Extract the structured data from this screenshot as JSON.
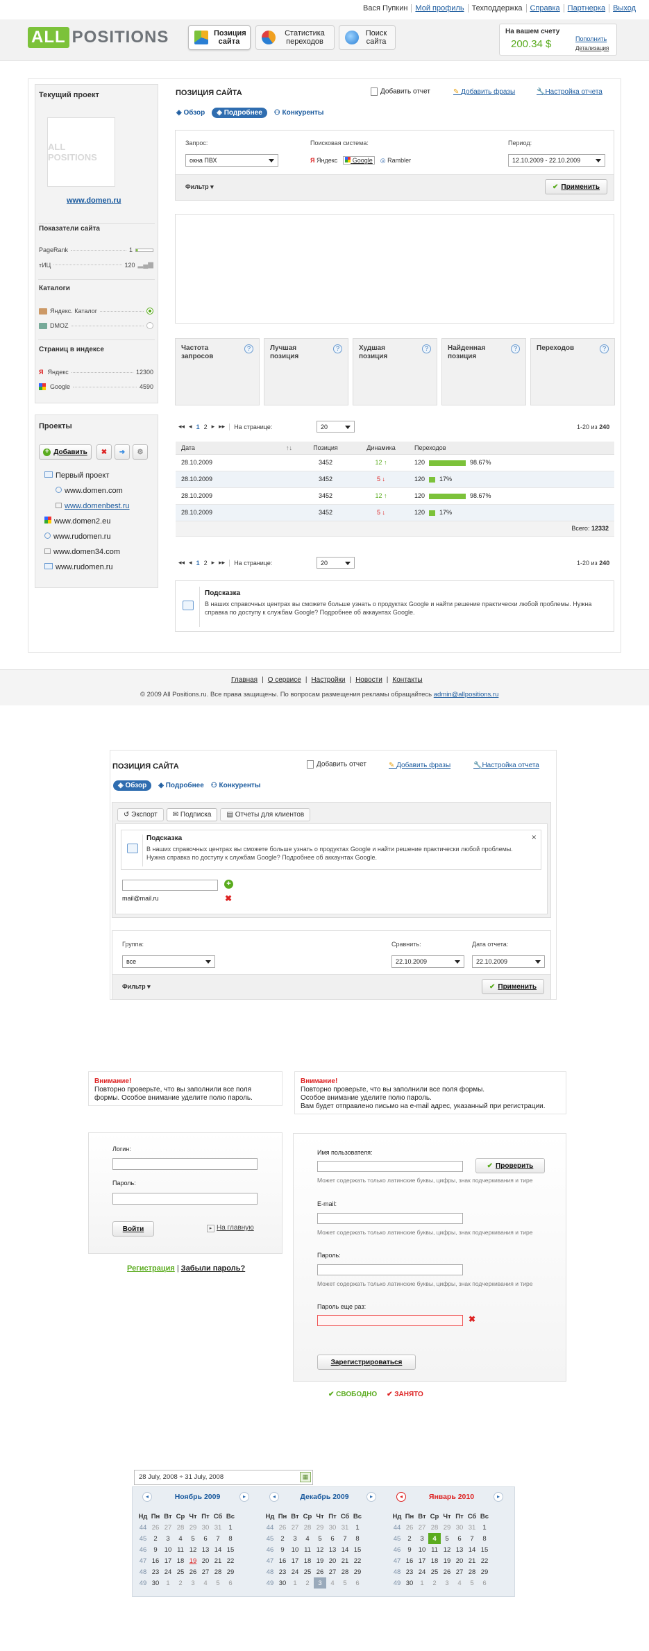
{
  "topnav": [
    "Вася Пупкин",
    "Мой профиль",
    "Техподдержка",
    "Справка",
    "Партнерка",
    "Выход"
  ],
  "logo": {
    "all": "ALL",
    "positions": "POSITIONS"
  },
  "mainnav": [
    {
      "label": "Позиция сайта",
      "color": "#2a7fd4"
    },
    {
      "label": "Статистика переходов",
      "color": "#f0a020"
    },
    {
      "label": "Поиск сайта",
      "color": "#3b8de0"
    }
  ],
  "account": {
    "title": "На вашем счету",
    "amount": "200.34 $",
    "topup": "Пополнить",
    "details": "Детализация"
  },
  "sidebar": {
    "current_project": "Текущий проект",
    "domain": "www.domen.ru",
    "indicators_title": "Показатели сайта",
    "pagerank_label": "PageRank",
    "pagerank_value": "1",
    "tic_label": "тИЦ",
    "tic_value": "120",
    "catalogs_title": "Каталоги",
    "catalog1": "Яндекс. Каталог",
    "catalog2": "DMOZ",
    "index_title": "Страниц в индексе",
    "index1_label": "Яндекс",
    "index1_value": "12300",
    "index2_label": "Google",
    "index2_value": "4590",
    "projects_title": "Проекты",
    "add_label": "Добавить",
    "tree": [
      "Первый проект",
      "www.domen.com",
      "www.domenbest.ru",
      "www.domen2.eu",
      "www.rudomen.ru",
      "www.domen34.com",
      "www.rudomen.ru"
    ]
  },
  "main": {
    "title": "ПОЗИЦИЯ САЙТА",
    "add_report": "Добавить отчет",
    "add_phrases": "Добавить фразы",
    "report_settings": "Настройка отчета",
    "tabs": [
      "Обзор",
      "Подробнее",
      "Конкуренты"
    ],
    "query_label": "Запрос:",
    "query_value": "окна ПВХ",
    "engine_label": "Поисковая система:",
    "engines": [
      "Яндекс",
      "Google",
      "Rambler"
    ],
    "period_label": "Период:",
    "period_value": "12.10.2009 - 22.10.2009",
    "filter": "Фильтр",
    "apply": "Применить",
    "metrics": [
      "Частота запросов",
      "Лучшая позиция",
      "Худшая позиция",
      "Найденная позиция",
      "Переходов"
    ],
    "pager": {
      "pages": [
        "1",
        "2"
      ],
      "per_page_label": "На странице:",
      "per_page": "20",
      "range": "1-20 из",
      "total": "240"
    },
    "table_headers": [
      "Дата",
      "Позиция",
      "Динамика",
      "Переходов"
    ],
    "rows": [
      {
        "date": "28.10.2009",
        "pos": "3452",
        "dyn": "12",
        "dir": "up",
        "clicks": "120",
        "pct": "98.67%",
        "fill": 0.9867
      },
      {
        "date": "28.10.2009",
        "pos": "3452",
        "dyn": "5",
        "dir": "down",
        "clicks": "120",
        "pct": "17%",
        "fill": 0.17
      },
      {
        "date": "28.10.2009",
        "pos": "3452",
        "dyn": "12",
        "dir": "up",
        "clicks": "120",
        "pct": "98.67%",
        "fill": 0.9867
      },
      {
        "date": "28.10.2009",
        "pos": "3452",
        "dyn": "5",
        "dir": "down",
        "clicks": "120",
        "pct": "17%",
        "fill": 0.17
      }
    ],
    "total_label": "Всего:",
    "total_value": "12332",
    "hint_title": "Подсказка",
    "hint_text": "В наших справочных центрах вы сможете больше узнать о продуктах Google и найти решение практически любой проблемы. Нужна справка по доступу к службам Google? Подробнее об аккаунтах Google."
  },
  "footer": {
    "links": [
      "Главная",
      "О сервисе",
      "Настройки",
      "Новости",
      "Контакты"
    ],
    "copyright": "© 2009 All Positions.ru. Все права защищены. По вопросам размещения рекламы обращайтесь",
    "email": "admin@allpositions.ru"
  },
  "panel2": {
    "title": "ПОЗИЦИЯ САЙТА",
    "add_report": "Добавить отчет",
    "add_phrases": "Добавить фразы",
    "report_settings": "Настройка отчета",
    "tabs": [
      "Обзор",
      "Подробнее",
      "Конкуренты"
    ],
    "subtabs": [
      "Экспорт",
      "Подписка",
      "Отчеты для клиентов"
    ],
    "hint_title": "Подсказка",
    "hint_text": "В наших справочных центрах вы сможете больше узнать о продуктах Google и найти решение практически любой проблемы. Нужна справка по доступу к службам Google? Подробнее об аккаунтах Google.",
    "email": "mail@mail.ru",
    "group_label": "Группа:",
    "group_value": "все",
    "compare_label": "Сравнить:",
    "compare_value": "22.10.2009",
    "date_label": "Дата отчета:",
    "date_value": "22.10.2009",
    "filter": "Фильтр",
    "apply": "Применить"
  },
  "login": {
    "warn_title": "Внимание!",
    "warn_text": "Повторно проверьте, что вы заполнили все поля формы. Особое внимание уделите полю пароль.",
    "login_label": "Логин:",
    "password_label": "Пароль:",
    "submit": "Войти",
    "home": "На главную",
    "register": "Регистрация",
    "forgot": "Забыли пароль?"
  },
  "register": {
    "warn_title": "Внимание!",
    "warn_text1": "Повторно проверьте, что вы заполнили все поля формы.",
    "warn_text2": "Особое внимание уделите полю пароль.",
    "warn_text3": "Вам будет отправлено письмо на e-mail адрес, указанный при регистрации.",
    "username_label": "Имя пользователя:",
    "check": "Проверить",
    "note": "Может содержать только латинские буквы, цифры, знак подчеркивания и тире",
    "email_label": "E-mail:",
    "password_label": "Пароль:",
    "password2_label": "Пароль еще раз:",
    "submit": "Зарегистрироваться",
    "free": "СВОБОДНО",
    "taken": "ЗАНЯТО"
  },
  "calendar": {
    "range": "28 July, 2008 ÷ 31 July, 2008",
    "days": [
      "Нд",
      "Пн",
      "Вт",
      "Ср",
      "Чт",
      "Пт",
      "Сб",
      "Вс"
    ],
    "months": [
      {
        "title": "Ноябрь 2009",
        "weeks": [
          [
            "44",
            "26",
            "27",
            "28",
            "29",
            "30",
            "31",
            "1"
          ],
          [
            "45",
            "2",
            "3",
            "4",
            "5",
            "6",
            "7",
            "8"
          ],
          [
            "46",
            "9",
            "10",
            "11",
            "12",
            "13",
            "14",
            "15"
          ],
          [
            "47",
            "16",
            "17",
            "18",
            "19",
            "20",
            "21",
            "22"
          ],
          [
            "48",
            "23",
            "24",
            "25",
            "26",
            "27",
            "28",
            "29"
          ],
          [
            "49",
            "30",
            "1",
            "2",
            "3",
            "4",
            "5",
            "6"
          ]
        ]
      },
      {
        "title": "Декабрь 2009",
        "weeks": [
          [
            "44",
            "26",
            "27",
            "28",
            "29",
            "30",
            "31",
            "1"
          ],
          [
            "45",
            "2",
            "3",
            "4",
            "5",
            "6",
            "7",
            "8"
          ],
          [
            "46",
            "9",
            "10",
            "11",
            "12",
            "13",
            "14",
            "15"
          ],
          [
            "47",
            "16",
            "17",
            "18",
            "19",
            "20",
            "21",
            "22"
          ],
          [
            "48",
            "23",
            "24",
            "25",
            "26",
            "27",
            "28",
            "29"
          ],
          [
            "49",
            "30",
            "1",
            "2",
            "3",
            "4",
            "5",
            "6"
          ]
        ]
      },
      {
        "title": "Январь 2010",
        "weeks": [
          [
            "44",
            "26",
            "27",
            "28",
            "29",
            "30",
            "31",
            "1"
          ],
          [
            "45",
            "2",
            "3",
            "4",
            "5",
            "6",
            "7",
            "8"
          ],
          [
            "46",
            "9",
            "10",
            "11",
            "12",
            "13",
            "14",
            "15"
          ],
          [
            "47",
            "16",
            "17",
            "18",
            "19",
            "20",
            "21",
            "22"
          ],
          [
            "48",
            "23",
            "24",
            "25",
            "26",
            "27",
            "28",
            "29"
          ],
          [
            "49",
            "30",
            "1",
            "2",
            "3",
            "4",
            "5",
            "6"
          ]
        ]
      }
    ]
  }
}
